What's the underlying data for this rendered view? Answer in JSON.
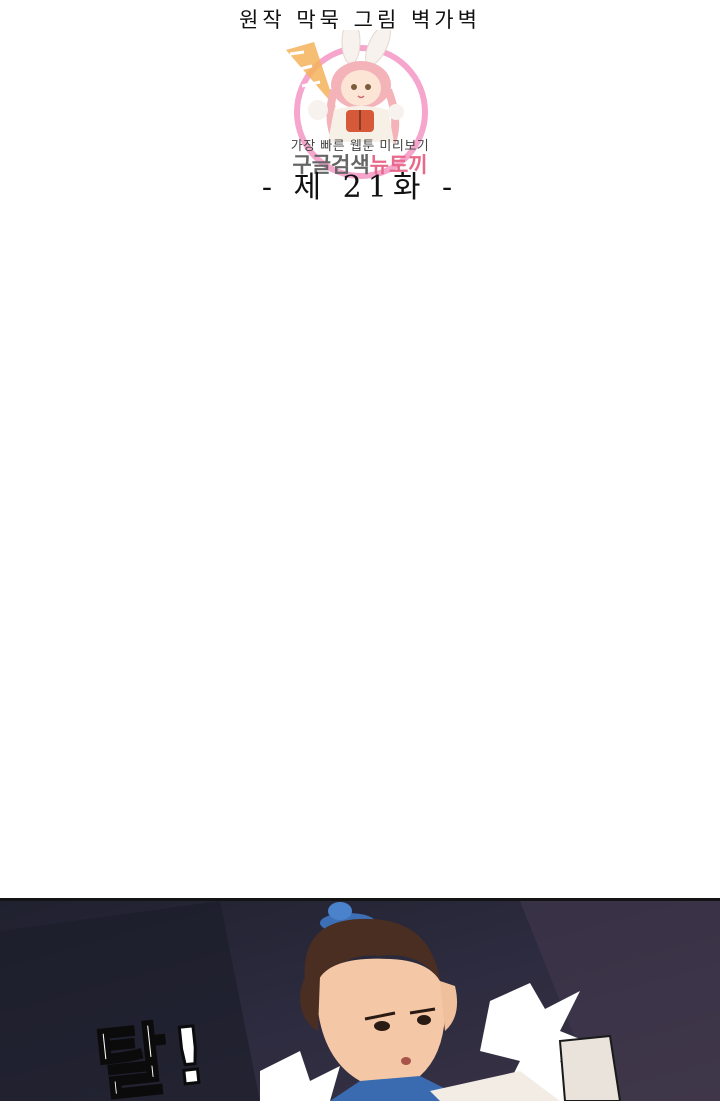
{
  "header": {
    "credits": "원작 막묵  그림 벽가벽",
    "episode": "- 제 21화 -"
  },
  "watermark": {
    "tagline": "가장 빠른 웹툰 미리보기",
    "brand_main": "구글검색",
    "brand_accent": "뉴토끼",
    "accent_color": "#e86a8a",
    "ring_color": "#f48fc0",
    "logo_text": ""
  },
  "comic_panel": {
    "sfx_text": "탈!",
    "background_color": "#2a2a3e",
    "character": "young man with topknot hat"
  }
}
